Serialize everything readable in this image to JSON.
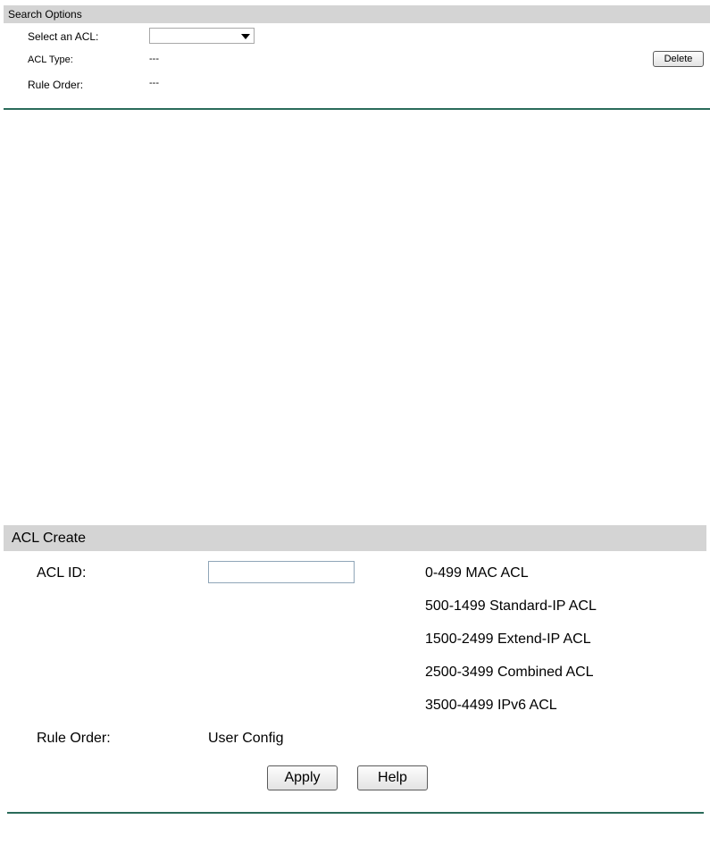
{
  "search_options": {
    "title": "Search Options",
    "select_acl_label": "Select an ACL:",
    "select_acl_value": "",
    "acl_type_label": "ACL Type:",
    "acl_type_value": "---",
    "rule_order_label": "Rule Order:",
    "rule_order_value": "---",
    "delete_label": "Delete"
  },
  "acl_create": {
    "title": "ACL Create",
    "acl_id_label": "ACL ID:",
    "acl_id_value": "",
    "ranges": [
      "0-499 MAC ACL",
      "500-1499 Standard-IP ACL",
      "1500-2499 Extend-IP ACL",
      "2500-3499 Combined ACL",
      "3500-4499 IPv6 ACL"
    ],
    "rule_order_label": "Rule Order:",
    "rule_order_value": "User Config",
    "apply_label": "Apply",
    "help_label": "Help"
  },
  "colors": {
    "header_bg": "#d4d4d4",
    "divider": "#2a6b5a"
  }
}
